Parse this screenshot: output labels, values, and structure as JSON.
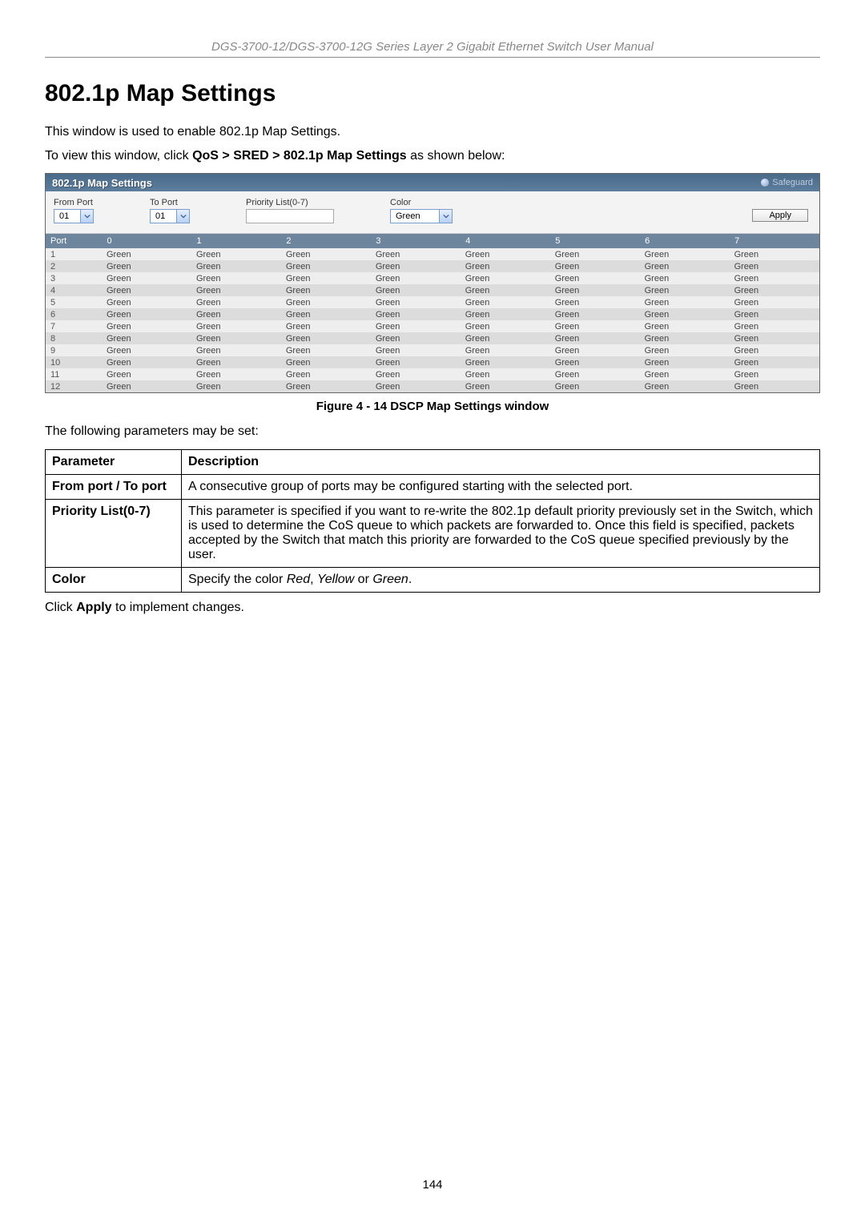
{
  "header": "DGS-3700-12/DGS-3700-12G Series Layer 2 Gigabit Ethernet Switch User Manual",
  "section_title": "802.1p Map Settings",
  "intro": "This window is used to enable 802.1p Map Settings.",
  "breadcrumb_prefix": "To view this window, click ",
  "breadcrumb_bold": "QoS > SRED > 802.1p Map Settings",
  "breadcrumb_suffix": " as shown below:",
  "screenshot": {
    "title": "802.1p Map Settings",
    "safeguard": "Safeguard",
    "from_port_label": "From Port",
    "from_port_value": "01",
    "to_port_label": "To Port",
    "to_port_value": "01",
    "priority_label": "Priority List(0-7)",
    "priority_value": "",
    "color_label": "Color",
    "color_value": "Green",
    "apply_label": "Apply",
    "columns": [
      "Port",
      "0",
      "1",
      "2",
      "3",
      "4",
      "5",
      "6",
      "7"
    ],
    "rows": [
      {
        "port": "1",
        "vals": [
          "Green",
          "Green",
          "Green",
          "Green",
          "Green",
          "Green",
          "Green",
          "Green"
        ]
      },
      {
        "port": "2",
        "vals": [
          "Green",
          "Green",
          "Green",
          "Green",
          "Green",
          "Green",
          "Green",
          "Green"
        ]
      },
      {
        "port": "3",
        "vals": [
          "Green",
          "Green",
          "Green",
          "Green",
          "Green",
          "Green",
          "Green",
          "Green"
        ]
      },
      {
        "port": "4",
        "vals": [
          "Green",
          "Green",
          "Green",
          "Green",
          "Green",
          "Green",
          "Green",
          "Green"
        ]
      },
      {
        "port": "5",
        "vals": [
          "Green",
          "Green",
          "Green",
          "Green",
          "Green",
          "Green",
          "Green",
          "Green"
        ]
      },
      {
        "port": "6",
        "vals": [
          "Green",
          "Green",
          "Green",
          "Green",
          "Green",
          "Green",
          "Green",
          "Green"
        ]
      },
      {
        "port": "7",
        "vals": [
          "Green",
          "Green",
          "Green",
          "Green",
          "Green",
          "Green",
          "Green",
          "Green"
        ]
      },
      {
        "port": "8",
        "vals": [
          "Green",
          "Green",
          "Green",
          "Green",
          "Green",
          "Green",
          "Green",
          "Green"
        ]
      },
      {
        "port": "9",
        "vals": [
          "Green",
          "Green",
          "Green",
          "Green",
          "Green",
          "Green",
          "Green",
          "Green"
        ]
      },
      {
        "port": "10",
        "vals": [
          "Green",
          "Green",
          "Green",
          "Green",
          "Green",
          "Green",
          "Green",
          "Green"
        ]
      },
      {
        "port": "11",
        "vals": [
          "Green",
          "Green",
          "Green",
          "Green",
          "Green",
          "Green",
          "Green",
          "Green"
        ]
      },
      {
        "port": "12",
        "vals": [
          "Green",
          "Green",
          "Green",
          "Green",
          "Green",
          "Green",
          "Green",
          "Green"
        ]
      }
    ]
  },
  "figure_caption": "Figure 4 - 14 DSCP Map Settings window",
  "params_intro": "The following parameters may be set:",
  "param_header": {
    "param": "Parameter",
    "desc": "Description"
  },
  "params": [
    {
      "name": "From port / To port",
      "desc": "A consecutive group of ports may be configured starting with the selected port."
    },
    {
      "name": "Priority List(0-7)",
      "desc": "This parameter is specified if you want to re-write the 802.1p default priority previously set in the Switch, which is used to determine the CoS queue to which packets are forwarded to. Once this field is specified, packets accepted by the Switch that match this priority are forwarded to the CoS queue specified previously by the user."
    },
    {
      "name": "Color",
      "desc_prefix": "Specify the color ",
      "desc_red": "Red",
      "desc_mid1": ", ",
      "desc_yellow": "Yellow",
      "desc_mid2": " or ",
      "desc_green": "Green",
      "desc_suffix": "."
    }
  ],
  "apply_note_prefix": "Click ",
  "apply_note_bold": "Apply",
  "apply_note_suffix": " to implement changes.",
  "page_number": "144"
}
